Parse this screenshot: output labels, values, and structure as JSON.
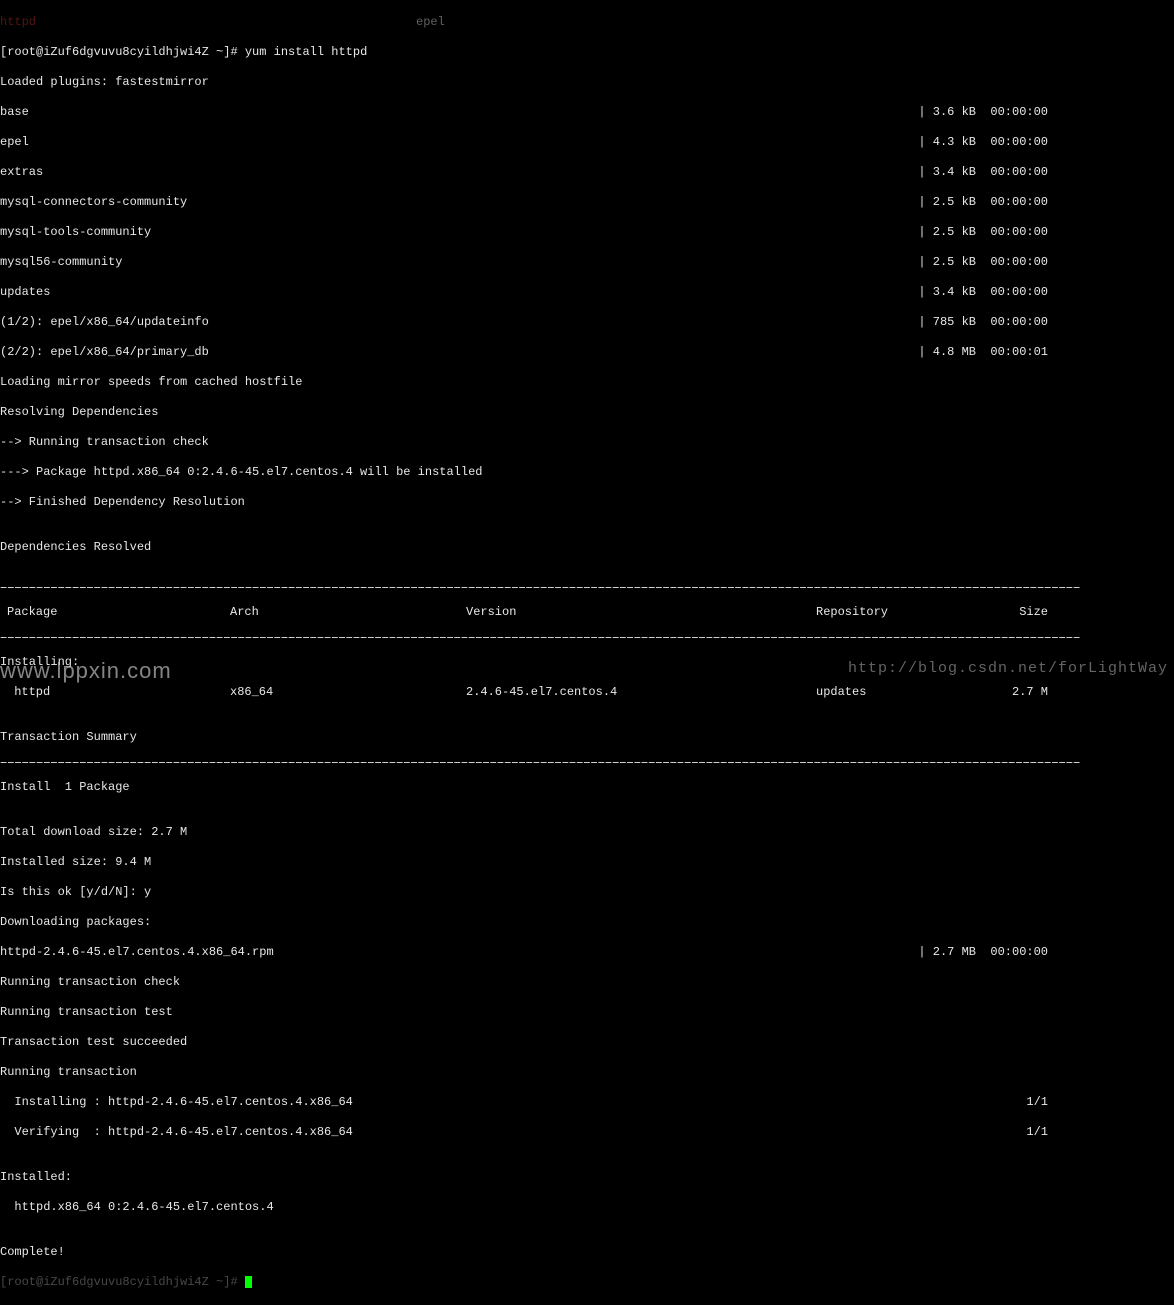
{
  "top_truncated": {
    "left_fragment1": "",
    "red_word": "httpd",
    "left_fragment2": "",
    "right_fragment": "epel"
  },
  "prompt": {
    "prefix": "[root@iZuf6dgvuvu8cyildhjwi4Z ~]# ",
    "command": "yum install httpd"
  },
  "plugins_line": "Loaded plugins: fastestmirror",
  "repos": [
    {
      "name": "base",
      "size": "3.6 kB",
      "time": "00:00:00"
    },
    {
      "name": "epel",
      "size": "4.3 kB",
      "time": "00:00:00"
    },
    {
      "name": "extras",
      "size": "3.4 kB",
      "time": "00:00:00"
    },
    {
      "name": "mysql-connectors-community",
      "size": "2.5 kB",
      "time": "00:00:00"
    },
    {
      "name": "mysql-tools-community",
      "size": "2.5 kB",
      "time": "00:00:00"
    },
    {
      "name": "mysql56-community",
      "size": "2.5 kB",
      "time": "00:00:00"
    },
    {
      "name": "updates",
      "size": "3.4 kB",
      "time": "00:00:00"
    },
    {
      "name": "(1/2): epel/x86_64/updateinfo",
      "size": "785 kB",
      "time": "00:00:00"
    },
    {
      "name": "(2/2): epel/x86_64/primary_db",
      "size": "4.8 MB",
      "time": "00:00:01"
    }
  ],
  "after_repos": [
    "Loading mirror speeds from cached hostfile",
    "Resolving Dependencies",
    "--> Running transaction check",
    "---> Package httpd.x86_64 0:2.4.6-45.el7.centos.4 will be installed",
    "--> Finished Dependency Resolution",
    "",
    "Dependencies Resolved",
    ""
  ],
  "table": {
    "headers": {
      "pkg": "Package",
      "arch": "Arch",
      "ver": "Version",
      "repo": "Repository",
      "size": "Size"
    },
    "installing_label": "Installing:",
    "row": {
      "pkg": " httpd",
      "arch": "x86_64",
      "ver": "2.4.6-45.el7.centos.4",
      "repo": "updates",
      "size": "2.7 M"
    }
  },
  "summary": [
    "",
    "Transaction Summary"
  ],
  "install_line": "Install  1 Package",
  "post_summary": [
    "",
    "Total download size: 2.7 M",
    "Installed size: 9.4 M",
    "Is this ok [y/d/N]: y",
    "Downloading packages:"
  ],
  "download": {
    "name": "httpd-2.4.6-45.el7.centos.4.x86_64.rpm",
    "size": "2.7 MB",
    "time": "00:00:00"
  },
  "after_download": [
    "Running transaction check",
    "Running transaction test",
    "Transaction test succeeded",
    "Running transaction"
  ],
  "progress": [
    {
      "label": "  Installing : httpd-2.4.6-45.el7.centos.4.x86_64",
      "count": "1/1"
    },
    {
      "label": "  Verifying  : httpd-2.4.6-45.el7.centos.4.x86_64",
      "count": "1/1"
    }
  ],
  "installed": [
    "",
    "Installed:",
    "  httpd.x86_64 0:2.4.6-45.el7.centos.4",
    "",
    "Complete!"
  ],
  "watermark1": "www.lppxin.com",
  "watermark2": "http://blog.csdn.net/forLightWay"
}
